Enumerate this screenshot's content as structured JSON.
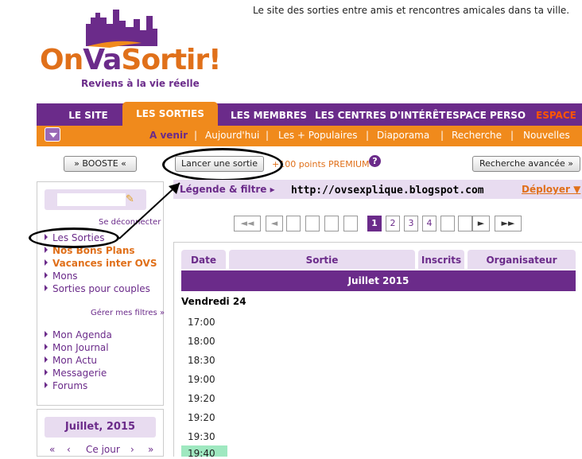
{
  "header": {
    "tagline": "Le site des sorties entre amis et rencontres amicales dans ta ville.",
    "logo_on": "On",
    "logo_va": "Va",
    "logo_sortir": "Sortir!",
    "logo_slogan": "Reviens à la vie réelle"
  },
  "nav": {
    "tabs": [
      "LE SITE",
      "LES SORTIES",
      "LES MEMBRES",
      "LES CENTRES D'INTÉRÊT",
      "ESPACE PERSO",
      "ESPACE"
    ],
    "subtabs": [
      "A venir",
      "Aujourd'hui",
      "Les + Populaires",
      "Diaporama",
      "Recherche",
      "Nouvelles"
    ]
  },
  "toolbar": {
    "boost_label": "» BOOSTE «",
    "create_label": "Lancer une sortie",
    "premium_text": "+100 points PREMIUM",
    "help_label": "?",
    "advanced_label": "Recherche avancée »"
  },
  "legend": {
    "label": "Légende & filtre ▸",
    "blog_url": "http://ovsexplique.blogspot.com",
    "deploy_label": "Déployer ▼"
  },
  "pager": {
    "first": "◄◄",
    "prev": "◄",
    "pages": [
      "1",
      "2",
      "3",
      "4"
    ],
    "current": "1",
    "next": "►",
    "last": "►►"
  },
  "table": {
    "headers": [
      "Date",
      "Sortie",
      "Inscrits",
      "Organisateur"
    ],
    "month": "Juillet 2015",
    "day": "Vendredi 24",
    "times": [
      "17:00",
      "18:00",
      "18:30",
      "19:00",
      "19:20",
      "19:20",
      "19:30",
      "19:40"
    ]
  },
  "sidebar": {
    "logout": "Se déconnecter",
    "items": [
      "Les Sorties",
      "Nos Bons Plans",
      "Vacances inter OVS",
      "Mons",
      "Sorties pour couples"
    ],
    "filters_link": "Gérer mes filtres »",
    "items2": [
      "Mon Agenda",
      "Mon Journal",
      "Mon Actu",
      "Messagerie",
      "Forums"
    ]
  },
  "calendar": {
    "month": "Juillet, 2015",
    "prev_prev": "«",
    "prev": "‹",
    "today": "Ce jour",
    "next": "›",
    "next_next": "»"
  },
  "colors": {
    "purple": "#6b2b8a",
    "orange": "#f08a1c",
    "lavender": "#e8dcf0"
  }
}
